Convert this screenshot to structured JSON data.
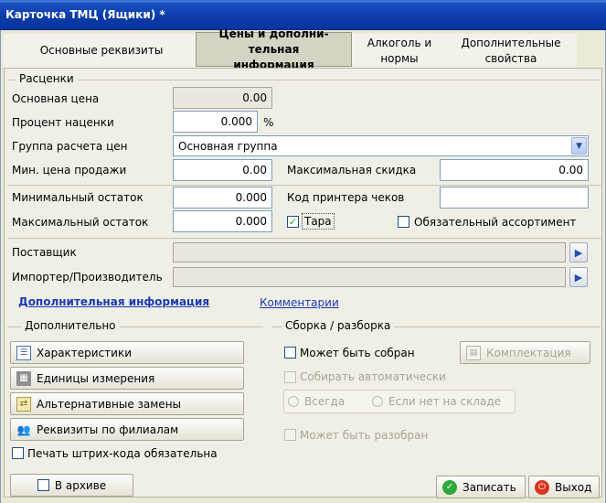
{
  "window": {
    "title": "Карточка ТМЦ (Ящики) *"
  },
  "tabs": [
    {
      "label": "Основные реквизиты"
    },
    {
      "label": "Цены и дополни-тельная информация"
    },
    {
      "label": "Алкоголь и нормы"
    },
    {
      "label": "Дополнительные свойства"
    }
  ],
  "pricing": {
    "group_title": "Расценки",
    "base_price_label": "Основная цена",
    "base_price_value": "0.00",
    "markup_label": "Процент наценки",
    "markup_value": "0.000",
    "markup_unit": "%",
    "price_group_label": "Группа расчета цен",
    "price_group_value": "Основная группа",
    "min_price_label": "Мин. цена продажи",
    "min_price_value": "0.00",
    "max_discount_label": "Максимальная скидка",
    "max_discount_value": "0.00"
  },
  "stock": {
    "min_label": "Минимальный остаток",
    "min_value": "0.000",
    "max_label": "Максимальный остаток",
    "max_value": "0.000",
    "printer_code_label": "Код принтера чеков",
    "printer_code_value": "",
    "tara_label": "Тара",
    "tara_checked": "✓",
    "mandatory_label": "Обязательный ассортимент"
  },
  "supplier": {
    "supplier_label": "Поставщик",
    "importer_label": "Импортер/Производитель"
  },
  "links": {
    "additional_info": "Дополнительная информация",
    "comments": "Комментарии"
  },
  "extra": {
    "group_title": "Дополнительно",
    "characteristics": "Характеристики",
    "units": "Единицы измерения",
    "alternatives": "Альтернативные замены",
    "branch_props": "Реквизиты по филиалам",
    "barcode_print": "Печать штрих-кода обязательна"
  },
  "assembly": {
    "group_title": "Сборка / разборка",
    "can_assemble": "Может быть собран",
    "kit_button": "Комплектация",
    "auto_assemble": "Собирать автоматически",
    "always": "Всегда",
    "if_not_in_stock": "Если нет на складе",
    "can_disassemble": "Может быть разобран"
  },
  "footer": {
    "archive": "В архиве",
    "save": "Записать",
    "exit": "Выход"
  },
  "colors": {
    "title_bar": "#0a3aa8",
    "accent_link": "#1a3bb0"
  }
}
